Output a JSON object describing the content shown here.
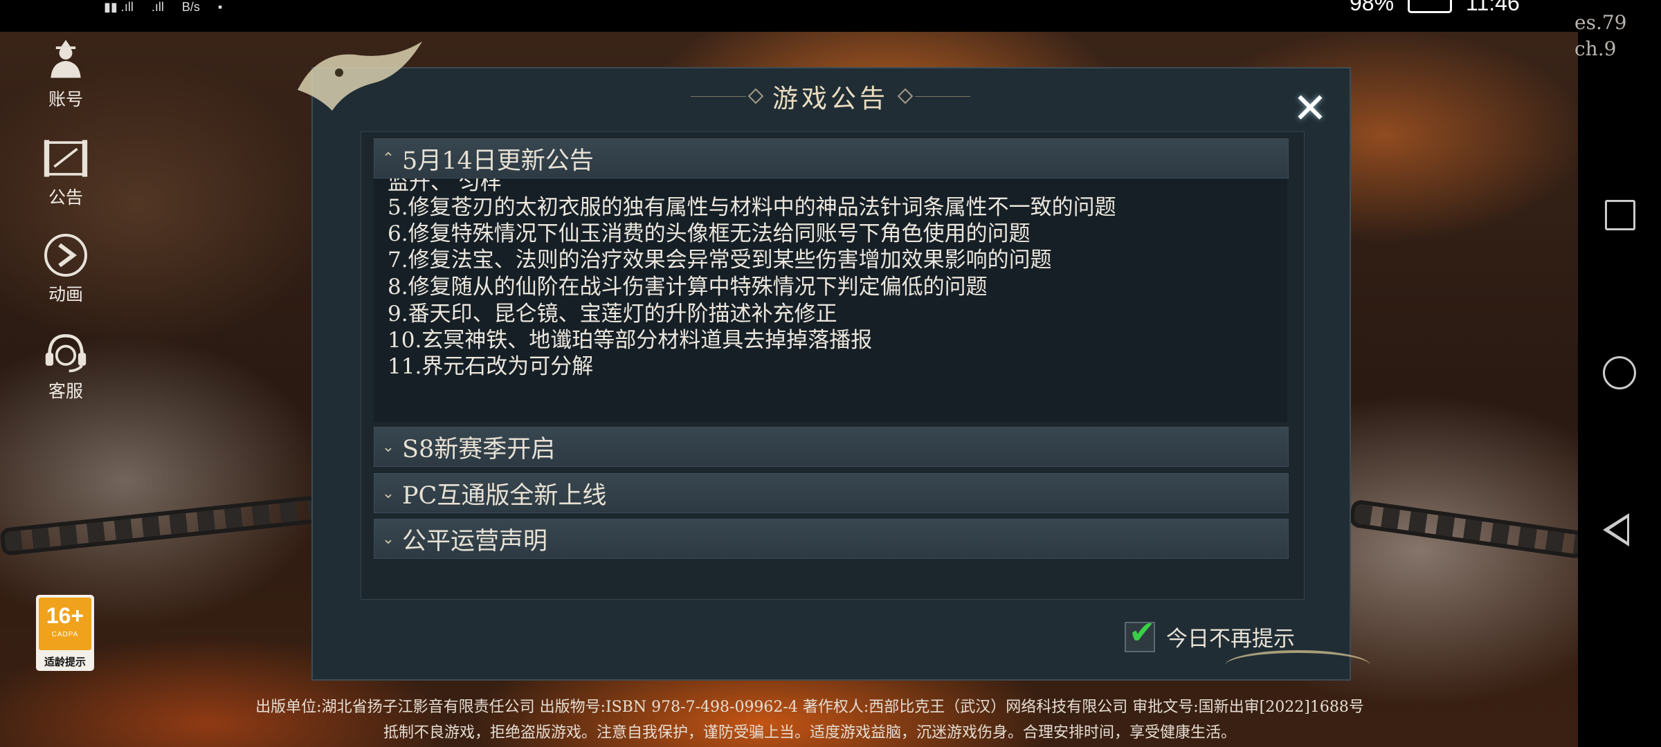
{
  "status_bar": {
    "network_speed": "B/s",
    "battery": "98%",
    "time": "11:46"
  },
  "overlay_version": [
    "es.79",
    "ch.9"
  ],
  "side_menu": [
    {
      "label": "账号",
      "icon": "account-icon"
    },
    {
      "label": "公告",
      "icon": "scroll-icon"
    },
    {
      "label": "动画",
      "icon": "play-icon"
    },
    {
      "label": "客服",
      "icon": "headset-icon"
    }
  ],
  "age_rating": {
    "number": "16+",
    "org": "CADPA",
    "label": "适龄提示"
  },
  "dialog": {
    "title": "游戏公告",
    "close": "✕",
    "sections": [
      {
        "title": "5月14日更新公告",
        "expanded": true,
        "lines": [
          "5.修复苍刃的太初衣服的独有属性与材料中的神品法针词条属性不一致的问题",
          "6.修复特殊情况下仙玉消费的头像框无法给同账号下角色使用的问题",
          "7.修复法宝、法则的治疗效果会异常受到某些伤害增加效果影响的问题",
          "8.修复随从的仙阶在战斗伤害计算中特殊情况下判定偏低的问题",
          "9.番天印、昆仑镜、宝莲灯的升阶描述补充修正",
          "10.玄冥神铁、地谶珀等部分材料道具去掉掉落播报",
          "11.界元石改为可分解"
        ]
      },
      {
        "title": "S8新赛季开启",
        "expanded": false
      },
      {
        "title": "PC互通版全新上线",
        "expanded": false
      },
      {
        "title": "公平运营声明",
        "expanded": false
      }
    ],
    "no_remind_label": "今日不再提示",
    "no_remind_checked": true
  },
  "footer": {
    "line1": "出版单位:湖北省扬子江影音有限责任公司 出版物号:ISBN 978-7-498-09962-4 著作权人:西部比克王（武汉）网络科技有限公司  审批文号:国新出审[2022]1688号",
    "line2": "抵制不良游戏，拒绝盗版游戏。注意自我保护，谨防受骗上当。适度游戏益脑，沉迷游戏伤身。合理安排时间，享受健康生活。"
  },
  "colors": {
    "dialog_bg": "#202d35",
    "header_bg": "#384650",
    "title_gold": "#e9dcc0",
    "check_green": "#3ad046",
    "age_orange": "#f0a21c"
  }
}
